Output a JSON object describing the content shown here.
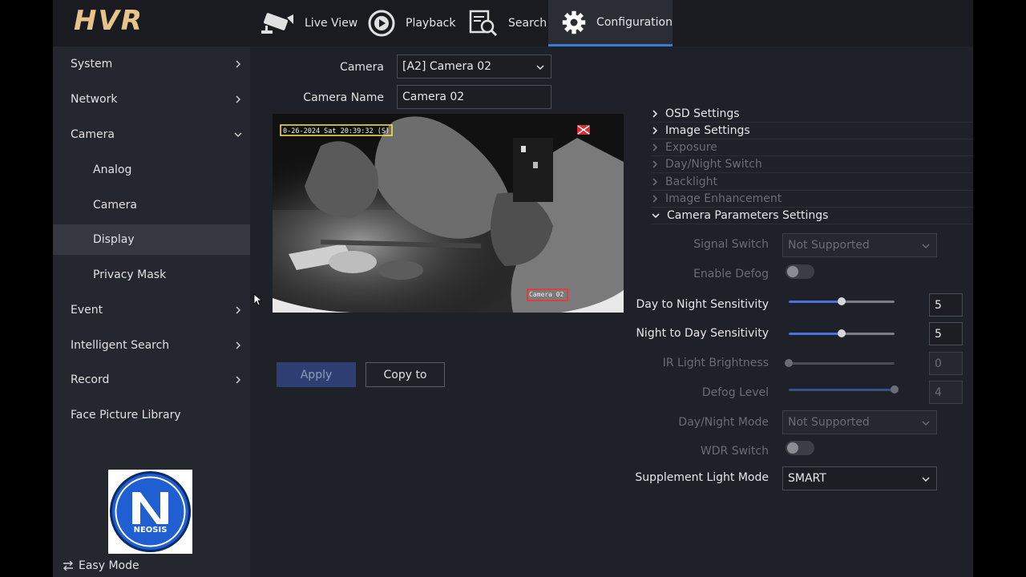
{
  "header": {
    "logo": "HVR",
    "nav": [
      {
        "label": "Live View",
        "icon": "camera-icon"
      },
      {
        "label": "Playback",
        "icon": "playback-icon"
      },
      {
        "label": "Search",
        "icon": "search-icon"
      },
      {
        "label": "Configuration",
        "icon": "gear-icon"
      }
    ]
  },
  "sidebar": {
    "items": [
      {
        "label": "System"
      },
      {
        "label": "Network"
      },
      {
        "label": "Camera"
      },
      {
        "label": "Analog"
      },
      {
        "label": "Camera"
      },
      {
        "label": "Display"
      },
      {
        "label": "Privacy Mask"
      },
      {
        "label": "Event"
      },
      {
        "label": "Intelligent Search"
      },
      {
        "label": "Record"
      },
      {
        "label": "Face Picture Library"
      }
    ],
    "brand_logo_text": "NEOSIS",
    "easy_mode": "Easy Mode"
  },
  "main": {
    "camera_label": "Camera",
    "camera_value": "[A2] Camera 02",
    "camera_name_label": "Camera Name",
    "camera_name_value": "Camera 02",
    "osd_timestamp": "0-26-2024 Sat 20:39:32 (S)",
    "osd_camera_name": "Camera 02",
    "apply_label": "Apply",
    "copy_label": "Copy to"
  },
  "panel": {
    "sections": [
      {
        "label": "OSD Settings",
        "enabled": true,
        "expanded": false
      },
      {
        "label": "Image Settings",
        "enabled": true,
        "expanded": false
      },
      {
        "label": "Exposure",
        "enabled": false,
        "expanded": false
      },
      {
        "label": "Day/Night Switch",
        "enabled": false,
        "expanded": false
      },
      {
        "label": "Backlight",
        "enabled": false,
        "expanded": false
      },
      {
        "label": "Image Enhancement",
        "enabled": false,
        "expanded": false
      },
      {
        "label": "Camera Parameters Settings",
        "enabled": true,
        "expanded": true
      }
    ],
    "signal_switch": {
      "label": "Signal Switch",
      "value": "Not Supported"
    },
    "enable_defog": {
      "label": "Enable Defog",
      "on": false
    },
    "day_to_night": {
      "label": "Day to Night Sensitivity",
      "value": "5",
      "level": 0.5
    },
    "night_to_day": {
      "label": "Night to Day Sensitivity",
      "value": "5",
      "level": 0.5
    },
    "ir_brightness": {
      "label": "IR Light Brightness",
      "value": "0",
      "level": 0.0
    },
    "defog_level": {
      "label": "Defog Level",
      "value": "4",
      "level": 1.0
    },
    "day_night_mode": {
      "label": "Day/Night Mode",
      "value": "Not Supported"
    },
    "wdr_switch": {
      "label": "WDR Switch",
      "on": false
    },
    "supplement_light": {
      "label": "Supplement Light Mode",
      "value": "SMART"
    }
  },
  "colors": {
    "accent": "#3a7bd5",
    "slider_fill": "#4a6fe0",
    "logo": "#e6c48a"
  }
}
